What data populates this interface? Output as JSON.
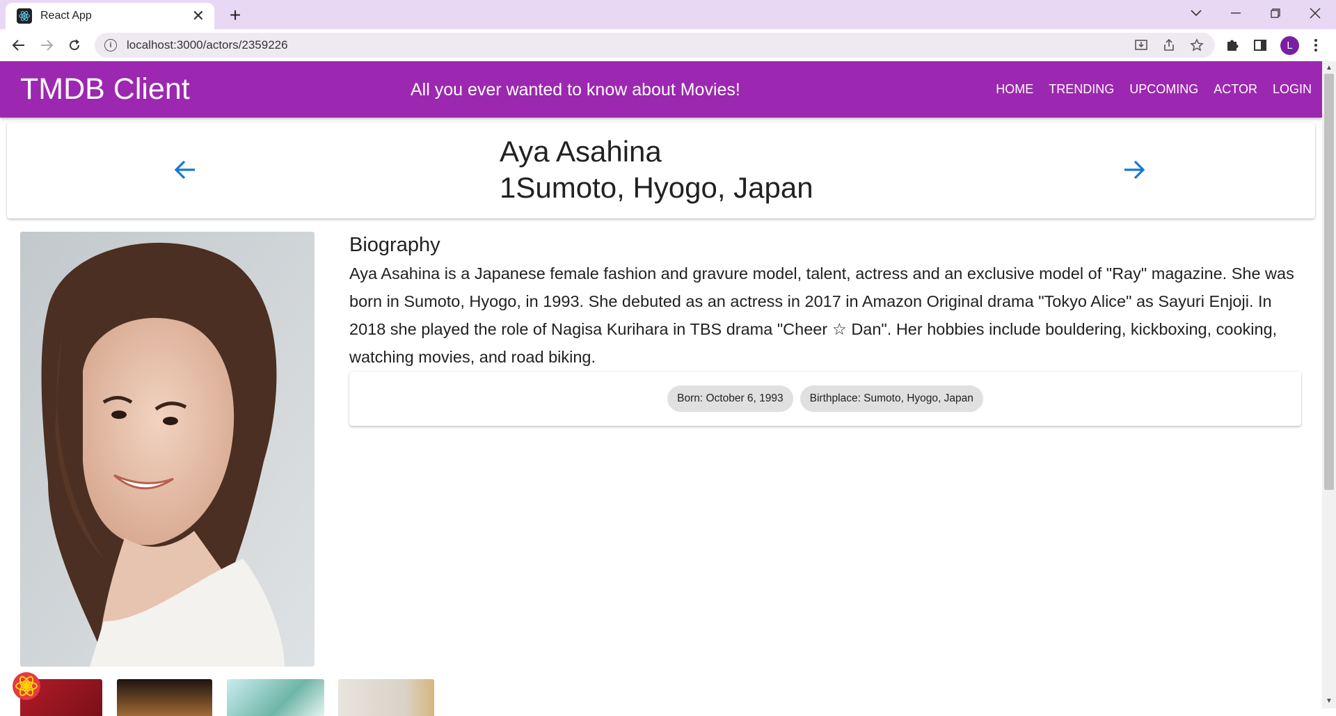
{
  "browser": {
    "tab_title": "React App",
    "url": "localhost:3000/actors/2359226",
    "profile_initial": "L"
  },
  "header": {
    "title": "TMDB Client",
    "tagline": "All you ever wanted to know about Movies!",
    "nav": [
      {
        "label": "Home"
      },
      {
        "label": "Trending"
      },
      {
        "label": "Upcoming"
      },
      {
        "label": "Actor"
      },
      {
        "label": "Login"
      }
    ]
  },
  "actor": {
    "name": "Aya Asahina",
    "subtitle": "1Sumoto, Hyogo, Japan",
    "biography_heading": "Biography",
    "biography": "Aya Asahina is a Japanese female fashion and gravure model, talent, actress and an exclusive model of \"Ray\" magazine. She was born in Sumoto, Hyogo, in 1993. She debuted as an actress in 2017 in Amazon Original drama \"Tokyo Alice\" as Sayuri Enjoji. In 2018 she played the role of Nagisa Kurihara in TBS drama \"Cheer ☆ Dan\". Her hobbies include bouldering, kickboxing, cooking, watching movies, and road biking.",
    "born_chip": "Born: October 6, 1993",
    "birthplace_chip": "Birthplace: Sumoto, Hyogo, Japan"
  },
  "colors": {
    "app_bar": "#9c27b0",
    "arrow": "#1976d2",
    "tab_strip": "#e9d8f4"
  }
}
